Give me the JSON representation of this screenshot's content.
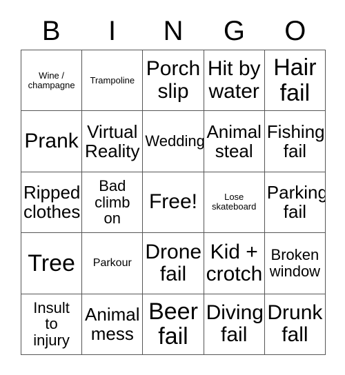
{
  "header": {
    "letters": [
      "B",
      "I",
      "N",
      "G",
      "O"
    ]
  },
  "grid": {
    "rows": 5,
    "columns": 5,
    "border_color": "#555555",
    "background_color": "#ffffff",
    "text_color": "#000000",
    "cells": [
      {
        "text": "Wine /\nchampagne",
        "size": "xs",
        "free": false
      },
      {
        "text": "Trampoline",
        "size": "xs",
        "free": false
      },
      {
        "text": "Porch\nslip",
        "size": "xl",
        "free": false
      },
      {
        "text": "Hit by\nwater",
        "size": "xl",
        "free": false
      },
      {
        "text": "Hair\nfail",
        "size": "xxl",
        "free": false
      },
      {
        "text": "Prank",
        "size": "xl",
        "free": false
      },
      {
        "text": "Virtual\nReality",
        "size": "lg",
        "free": false
      },
      {
        "text": "Wedding",
        "size": "md",
        "free": false
      },
      {
        "text": "Animal\nsteal",
        "size": "lg",
        "free": false
      },
      {
        "text": "Fishing\nfail",
        "size": "lg",
        "free": false
      },
      {
        "text": "Ripped\nclothes",
        "size": "lg",
        "free": false
      },
      {
        "text": "Bad\nclimb\non",
        "size": "md",
        "free": false
      },
      {
        "text": "Free!",
        "size": "xl",
        "free": true
      },
      {
        "text": "Lose\nskateboard",
        "size": "xs",
        "free": false
      },
      {
        "text": "Parking\nfail",
        "size": "lg",
        "free": false
      },
      {
        "text": "Tree",
        "size": "xxl",
        "free": false
      },
      {
        "text": "Parkour",
        "size": "sm",
        "free": false
      },
      {
        "text": "Drone\nfail",
        "size": "xl",
        "free": false
      },
      {
        "text": "Kid +\ncrotch",
        "size": "xl",
        "free": false
      },
      {
        "text": "Broken\nwindow",
        "size": "md",
        "free": false
      },
      {
        "text": "Insult\nto\ninjury",
        "size": "md",
        "free": false
      },
      {
        "text": "Animal\nmess",
        "size": "lg",
        "free": false
      },
      {
        "text": "Beer\nfail",
        "size": "xxl",
        "free": false
      },
      {
        "text": "Diving\nfail",
        "size": "xl",
        "free": false
      },
      {
        "text": "Drunk\nfall",
        "size": "xl",
        "free": false
      }
    ]
  }
}
